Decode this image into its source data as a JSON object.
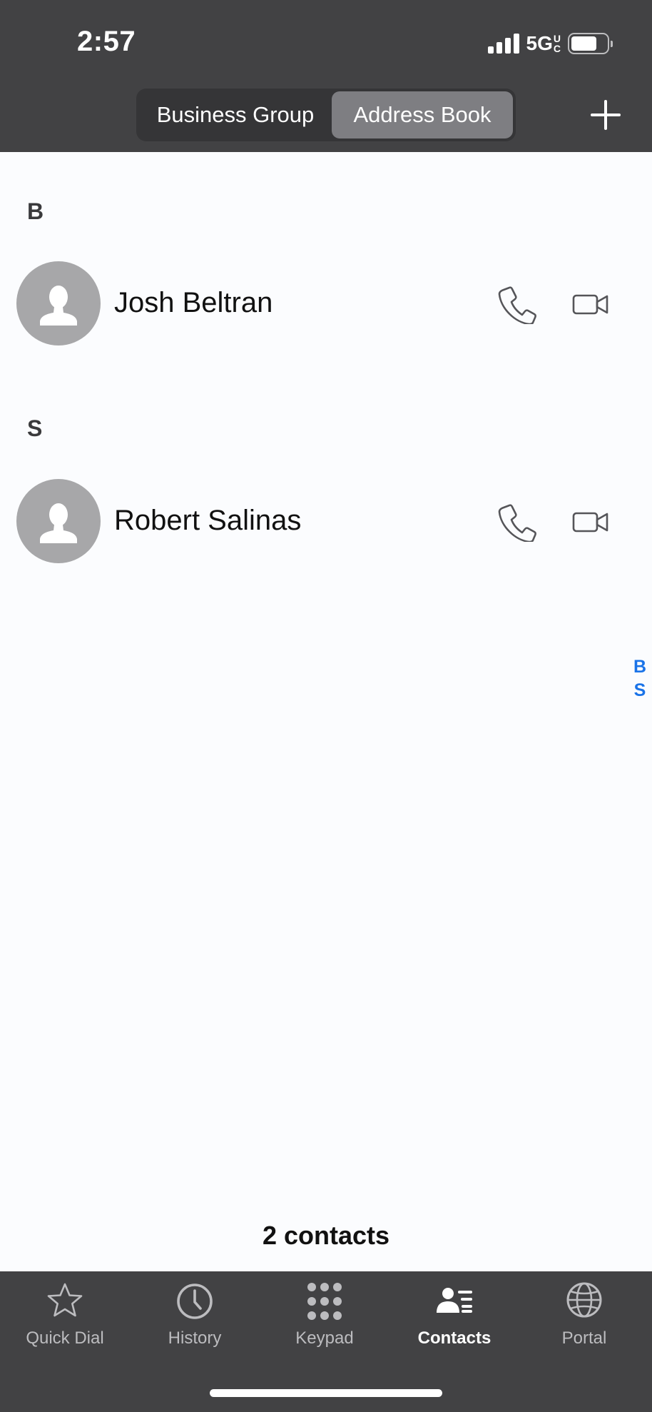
{
  "status_bar": {
    "time": "2:57",
    "network": "5G",
    "network_sup_top": "U",
    "network_sup_bottom": "C"
  },
  "header": {
    "segments": [
      {
        "label": "Business Group",
        "active": false
      },
      {
        "label": "Address Book",
        "active": true
      }
    ],
    "add_icon": "plus-icon"
  },
  "sections": [
    {
      "letter": "B",
      "contacts": [
        {
          "name": "Josh Beltran",
          "avatar_icon": "person-silhouette-icon",
          "call_icon": "phone-icon",
          "video_icon": "video-camera-icon"
        }
      ]
    },
    {
      "letter": "S",
      "contacts": [
        {
          "name": "Robert Salinas",
          "avatar_icon": "person-silhouette-icon",
          "call_icon": "phone-icon",
          "video_icon": "video-camera-icon"
        }
      ]
    }
  ],
  "index_bar": [
    "B",
    "S"
  ],
  "footer": {
    "count_text": "2 contacts"
  },
  "tabs": [
    {
      "label": "Quick Dial",
      "icon": "star-icon",
      "active": false
    },
    {
      "label": "History",
      "icon": "clock-icon",
      "active": false
    },
    {
      "label": "Keypad",
      "icon": "keypad-icon",
      "active": false
    },
    {
      "label": "Contacts",
      "icon": "contacts-icon",
      "active": true
    },
    {
      "label": "Portal",
      "icon": "globe-icon",
      "active": false
    }
  ],
  "colors": {
    "header_bg": "#424244",
    "segment_active": "#7e7e82",
    "content_bg": "#fbfcfe",
    "index_accent": "#1a73e8",
    "avatar_bg": "#a7a7a9"
  }
}
